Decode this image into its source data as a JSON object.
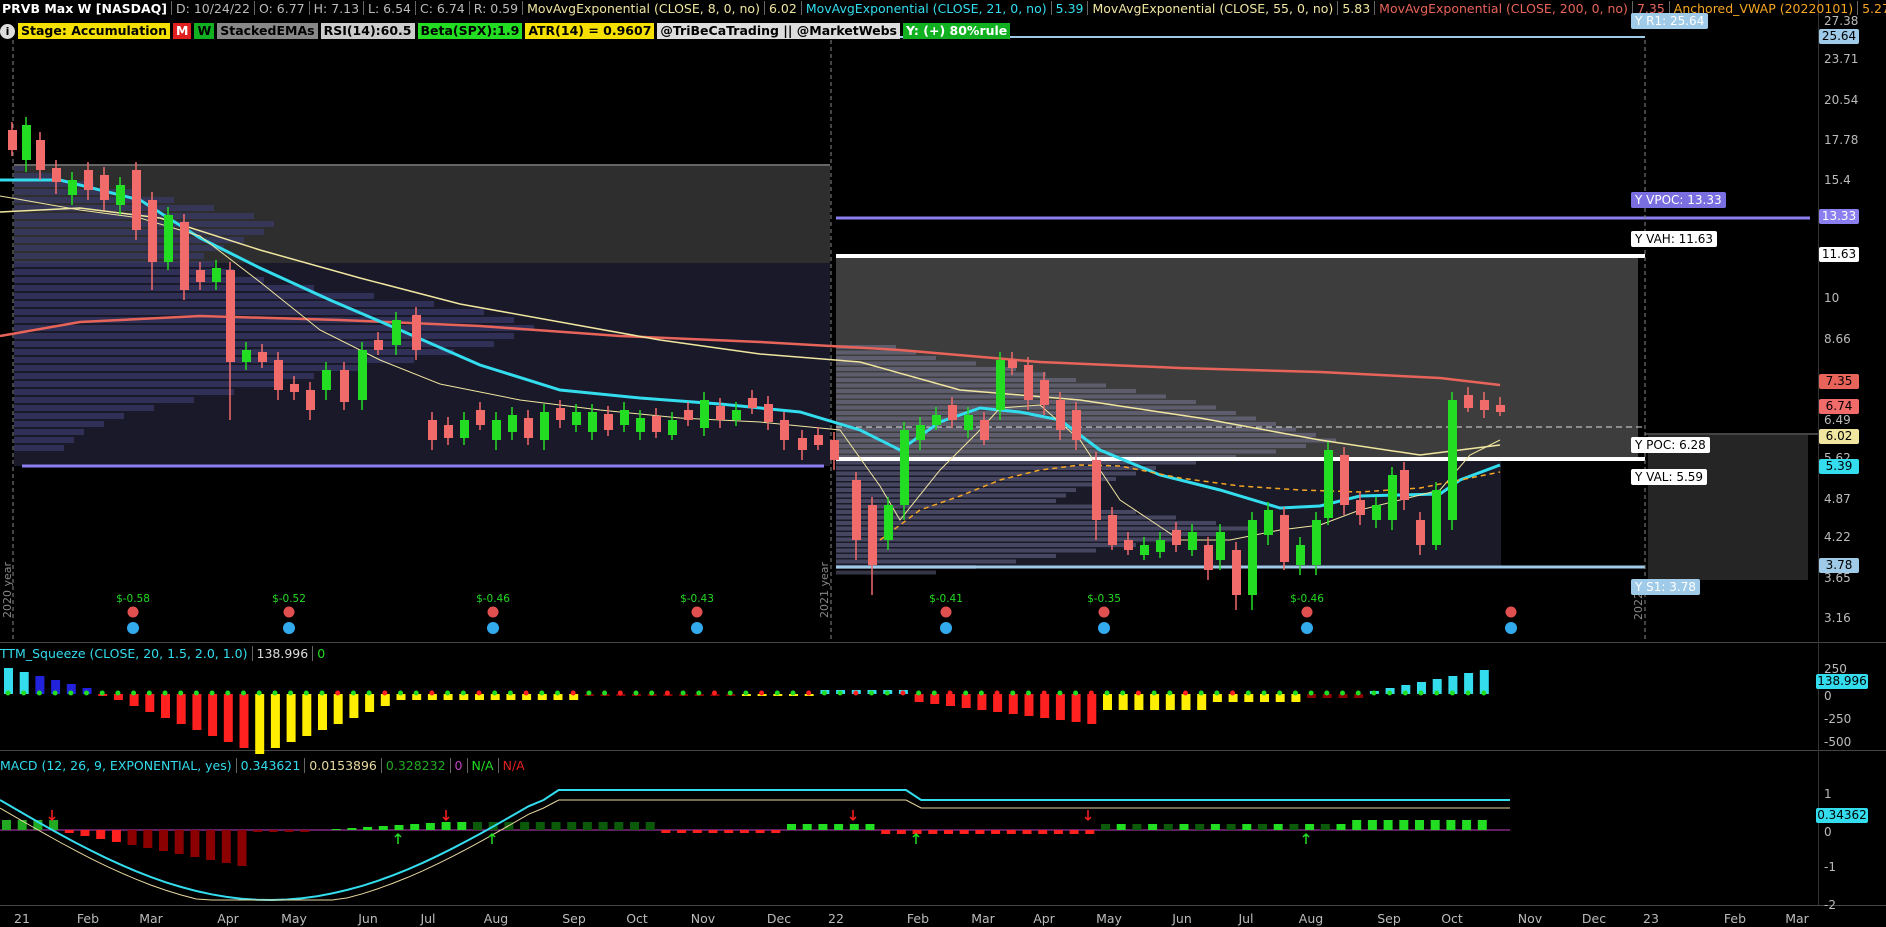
{
  "header": {
    "symbol": "PRVB Max W [NASDAQ]",
    "date": "D: 10/24/22",
    "open": "O: 6.77",
    "high": "H: 7.13",
    "low": "L: 6.54",
    "close": "C: 6.74",
    "range": "R: 0.59",
    "ema8_label": "MovAvgExponential (CLOSE, 8, 0, no)",
    "ema8_value": "6.02",
    "ema21_label": "MovAvgExponential (CLOSE, 21, 0, no)",
    "ema21_value": "5.39",
    "ema55_label": "MovAvgExponential (CLOSE, 55, 0, no)",
    "ema55_value": "5.83",
    "ema200_label": "MovAvgExponential (CLOSE, 200, 0, no)",
    "ema200_value": "7.35",
    "vwap_label": "Anchored_VWAP (20220101)",
    "vwap_value": "5.27"
  },
  "studies": {
    "info": "i",
    "stage": "Stage: Accumulation",
    "m": "M",
    "w": "W",
    "stacked": "StackedEMAs",
    "rsi": "RSI(14):60.5",
    "beta": "Beta(SPX):1.9",
    "atr": "ATR(14) = 0.9607",
    "handle": "@TriBeCaTrading || @MarketWebs",
    "yperc": "Y: (+) 80%rule"
  },
  "price_axis": {
    "ticks": [
      "27.38",
      "23.71",
      "20.54",
      "17.78",
      "15.4",
      "13.33",
      "11.63",
      "10",
      "8.66",
      "7.5",
      "6.49",
      "5.62",
      "4.87",
      "4.22",
      "3.65",
      "3.16"
    ],
    "pills": {
      "yr1": "25.64",
      "vpoc": "13.33",
      "vah": "11.63",
      "ema200": "7.35",
      "last": "6.74",
      "ema8": "6.02",
      "ema21": "5.39",
      "ys1": "3.78"
    }
  },
  "callouts": {
    "yr1": "Y R1: 25.64",
    "vpoc": "Y VPOC: 13.33",
    "vah": "Y VAH: 11.63",
    "poc": "Y POC: 6.28",
    "val": "Y VAL: 5.59",
    "s1": "Y S1: 3.78"
  },
  "year_markers": {
    "y2020": "2020 year",
    "y2021": "2021 year",
    "y2022": "2022"
  },
  "earnings": [
    "$-0.58",
    "$-0.52",
    "$-0.46",
    "$-0.43",
    "$-0.41",
    "$-0.35",
    "$-0.46"
  ],
  "x_axis": [
    "21",
    "Feb",
    "Mar",
    "Apr",
    "May",
    "Jun",
    "Jul",
    "Aug",
    "Sep",
    "Oct",
    "Nov",
    "Dec",
    "22",
    "Feb",
    "Mar",
    "Apr",
    "May",
    "Jun",
    "Jul",
    "Aug",
    "Sep",
    "Oct",
    "Nov",
    "Dec",
    "23",
    "Feb",
    "Mar"
  ],
  "squeeze": {
    "label": "TTM_Squeeze (CLOSE, 20, 1.5, 2.0, 1.0)",
    "value": "138.996",
    "zero": "0",
    "axis": [
      "250",
      "0",
      "-250",
      "-500"
    ],
    "pill": "138.996"
  },
  "macd": {
    "label": "MACD (12, 26, 9, EXPONENTIAL, yes)",
    "value": "0.343621",
    "avg": "0.0153896",
    "diff": "0.328232",
    "zero": "0",
    "na1": "N/A",
    "na2": "N/A",
    "axis": [
      "1",
      "0",
      "-1",
      "-2"
    ],
    "pill": "0.34362"
  },
  "colors": {
    "up": "#22dd22",
    "down": "#f26b6b",
    "ema8": "#f0e6a0",
    "ema21": "#33ddee",
    "ema200": "#e8645a",
    "vwap": "#f5a623",
    "level_blue": "#9fcbe8",
    "level_purple": "#8b7ff0"
  }
}
